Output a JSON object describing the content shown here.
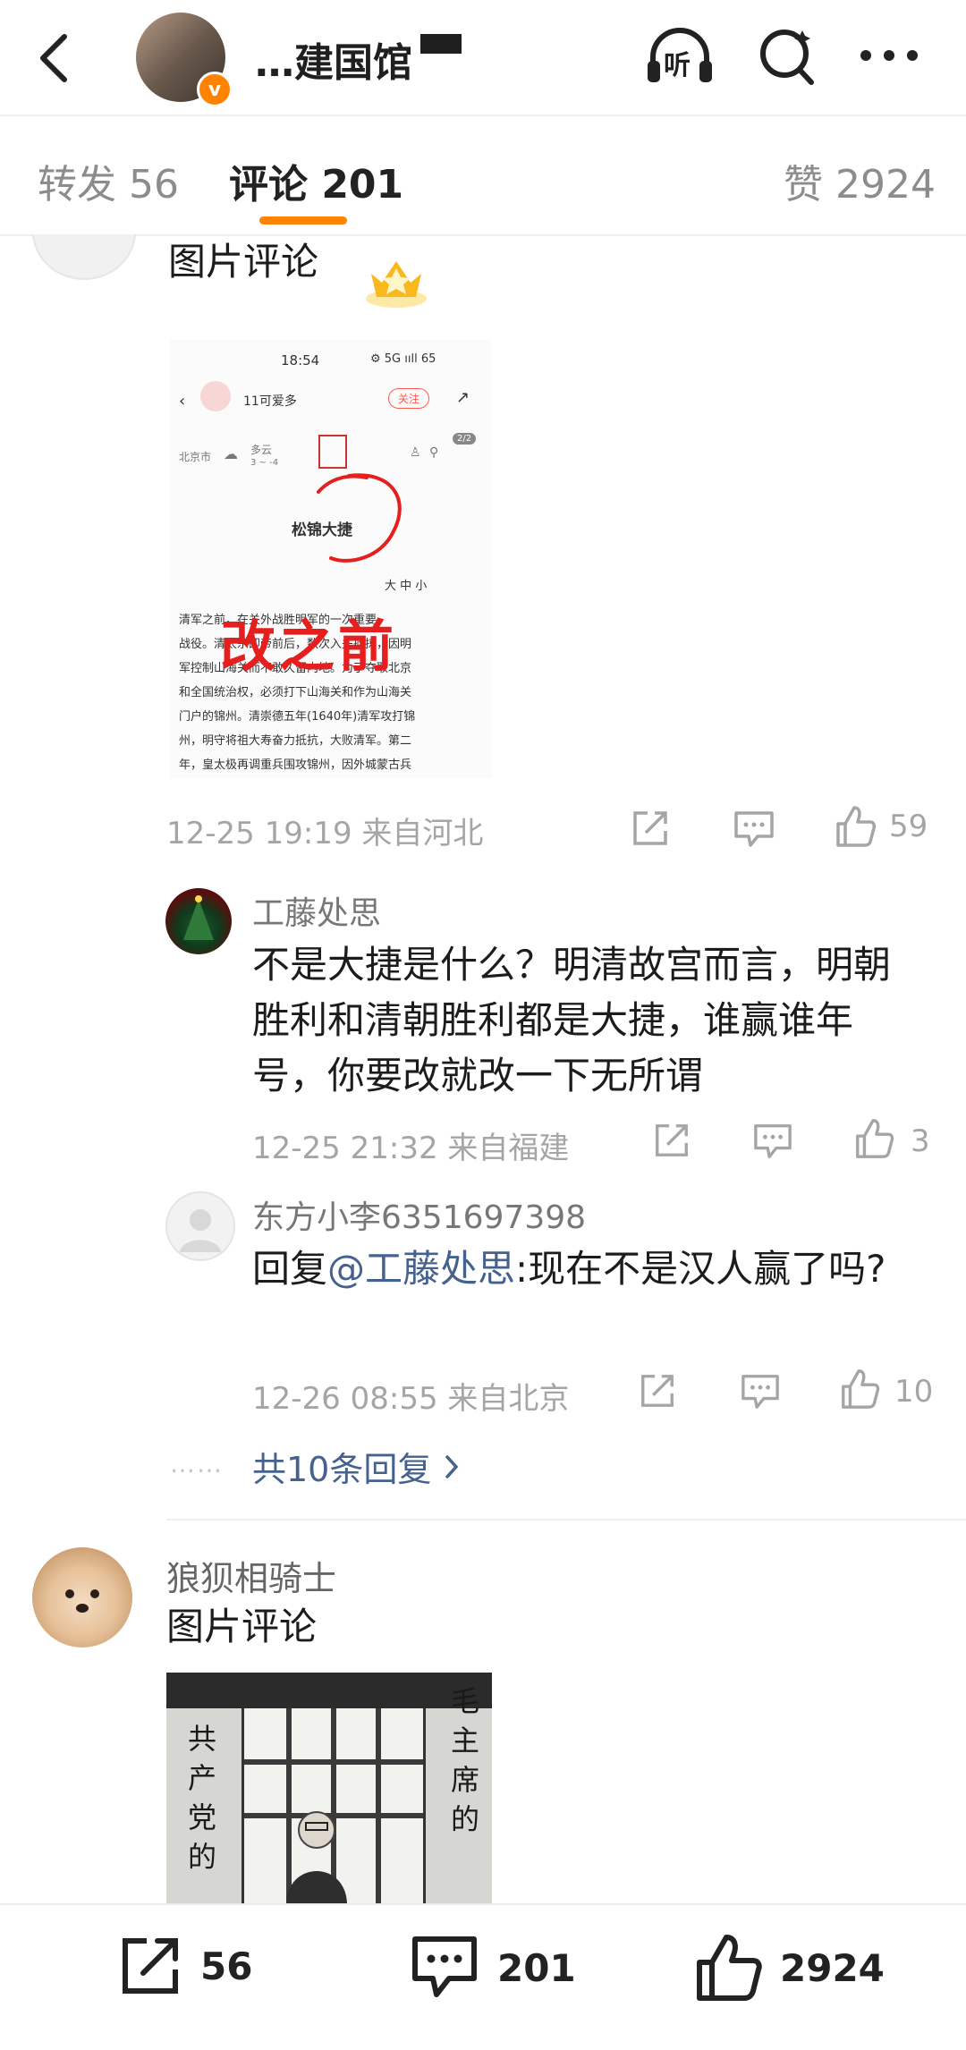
{
  "header": {
    "account_name": "…建国馆",
    "verified_badge": "v",
    "listen_label": "听"
  },
  "tabs": [
    {
      "label": "转发 56"
    },
    {
      "label": "评论 201"
    },
    {
      "label": "赞 2924"
    }
  ],
  "comment1": {
    "text": "图片评论",
    "image": {
      "status_time": "18:54",
      "status_icons": "⚙ 5G ııll 65",
      "user_name": "11可爱多",
      "follow_label": "关注",
      "weather_city": "北京市",
      "weather": "多云",
      "weather_range": "3 ~ -4",
      "page_indicator": "2/2",
      "article_title": "松锦大捷",
      "font_sizes": "大 中 小",
      "annotation": "改之前",
      "body_lines": [
        "清军之前，在关外战胜明军的一次重要",
        "战役。清太宗即帝前后，数次入关掳掠，因明",
        "军控制山海关而不敢久留内地。为了夺取北京",
        "和全国统治权，必须打下山海关和作为山海关",
        "门户的锦州。清崇德五年(1640年)清军攻打锦",
        "州，明守将祖大寿奋力抵抗，大败清军。第二",
        "年，皇太极再调重兵围攻锦州，因外城蒙古兵"
      ]
    },
    "meta": "12-25 19:19  来自河北",
    "likes": "59"
  },
  "reply1": {
    "username": "工藤处思",
    "text": "不是大捷是什么？明清故宫而言，明朝胜利和清朝胜利都是大捷，谁赢谁年号，你要改就改一下无所谓",
    "meta": "12-25 21:32  来自福建",
    "likes": "3"
  },
  "reply2": {
    "username": "东方小李6351697398",
    "prefix": "回复",
    "mention": "@工藤处思",
    "text": ":现在不是汉人赢了吗?",
    "meta": "12-26 08:55  来自北京",
    "likes": "10"
  },
  "more_replies": {
    "dots": "……",
    "label": "共10条回复"
  },
  "comment2": {
    "username": "狼狈相骑士",
    "text": "图片评论",
    "image_text_left": "共产党的",
    "image_text_right": "毛主席的"
  },
  "bottom_bar": {
    "repost_count": "56",
    "comment_count": "201",
    "like_count": "2924"
  },
  "colors": {
    "accent": "#ff8200",
    "link": "#45628f",
    "muted": "#9a9a9a"
  }
}
